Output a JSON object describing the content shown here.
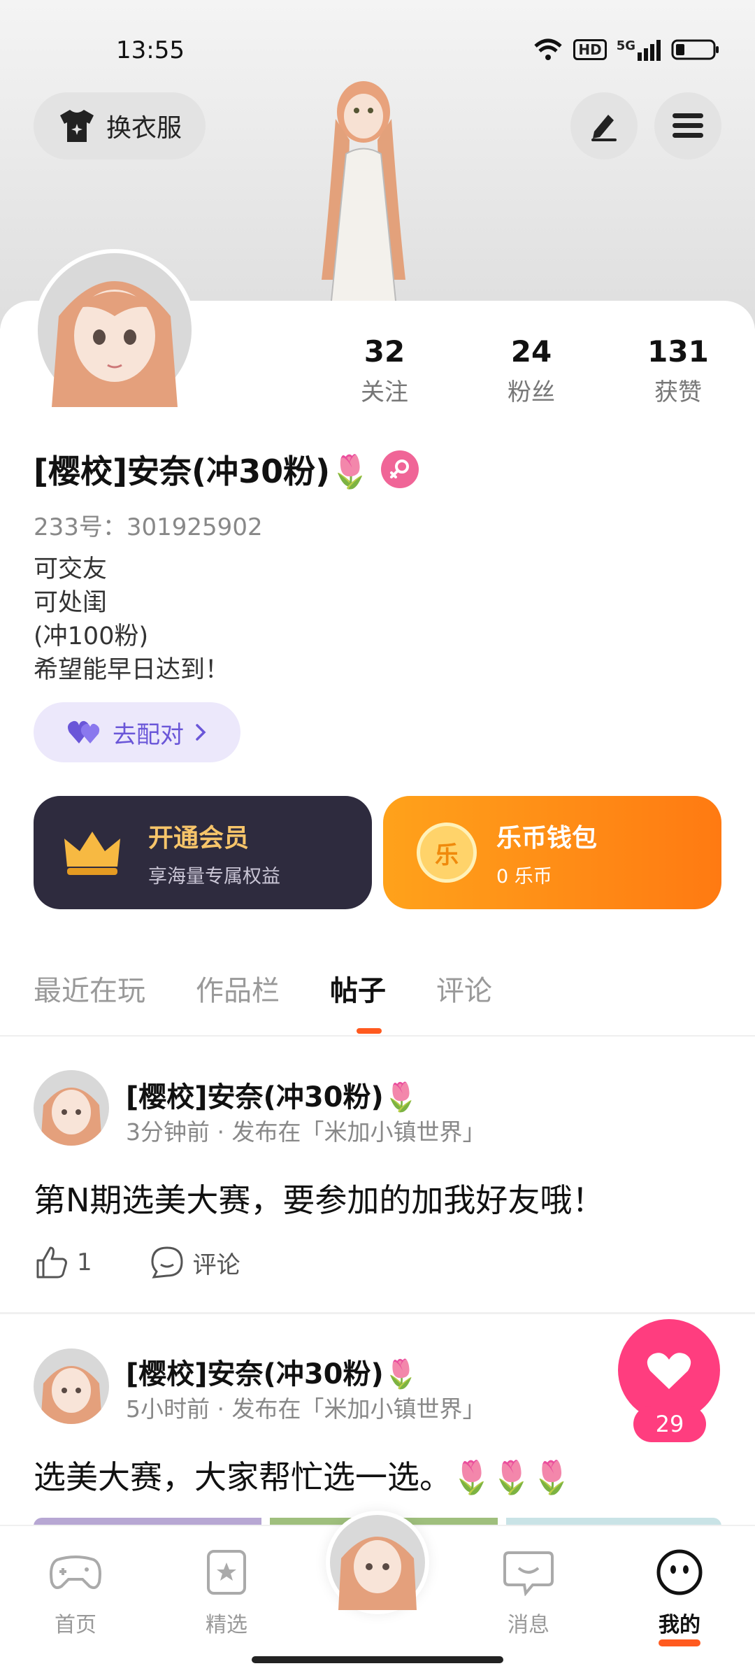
{
  "status": {
    "time": "13:55",
    "network": "5G",
    "hd": "HD"
  },
  "header": {
    "outfit_button": "换衣服"
  },
  "profile": {
    "stats": [
      {
        "value": "32",
        "label": "关注"
      },
      {
        "value": "24",
        "label": "粉丝"
      },
      {
        "value": "131",
        "label": "获赞"
      }
    ],
    "username": "[樱校]安奈(冲30粉)🌷",
    "uid": "233号：301925902",
    "bio": [
      "可交友",
      "可处闺",
      "(冲100粉)",
      "希望能早日达到！"
    ],
    "match_button": "去配对"
  },
  "promos": {
    "vip": {
      "title": "开通会员",
      "subtitle": "享海量专属权益",
      "title_color": "#f7c56a"
    },
    "wallet": {
      "title": "乐币钱包",
      "subtitle": "0 乐币",
      "coin_char": "乐"
    }
  },
  "tabs": [
    "最近在玩",
    "作品栏",
    "帖子",
    "评论"
  ],
  "active_tab": "帖子",
  "posts": [
    {
      "author": "[樱校]安奈(冲30粉)🌷",
      "meta": "3分钟前 · 发布在「米加小镇世界」",
      "text": "第N期选美大赛，要参加的加我好友哦！",
      "likes": "1",
      "comment_label": "评论"
    },
    {
      "author": "[樱校]安奈(冲30粉)🌷",
      "meta": "5小时前 · 发布在「米加小镇世界」",
      "text": "选美大赛，大家帮忙选一选。🌷🌷🌷"
    }
  ],
  "fab": {
    "count": "29"
  },
  "nav": [
    {
      "label": "首页",
      "icon": "gamepad-icon"
    },
    {
      "label": "精选",
      "icon": "star-card-icon"
    },
    {
      "label": "",
      "icon": "avatar"
    },
    {
      "label": "消息",
      "icon": "chat-icon"
    },
    {
      "label": "我的",
      "icon": "smiley-icon"
    }
  ],
  "colors": {
    "accent": "#ff5a1f",
    "pink": "#ff3d7f",
    "purple": "#6a56d8"
  }
}
